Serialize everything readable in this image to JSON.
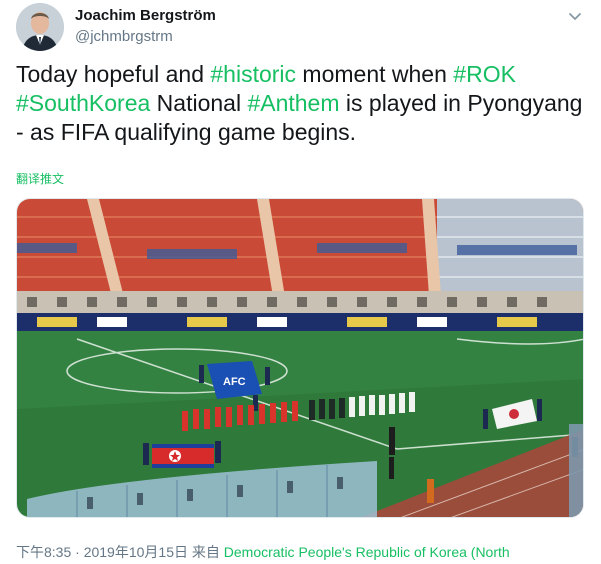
{
  "author": {
    "display_name": "Joachim Bergström",
    "handle": "@jchmbrgstrm"
  },
  "tweet": {
    "segments": [
      {
        "text": "Today hopeful and ",
        "type": "text"
      },
      {
        "text": "#historic",
        "type": "hashtag"
      },
      {
        "text": " moment when ",
        "type": "text"
      },
      {
        "text": "#ROK",
        "type": "hashtag"
      },
      {
        "text": " ",
        "type": "text"
      },
      {
        "text": "#SouthKorea",
        "type": "hashtag"
      },
      {
        "text": " National ",
        "type": "text"
      },
      {
        "text": "#Anthem",
        "type": "hashtag"
      },
      {
        "text": " is played in Pyongyang - as FIFA qualifying game begins.",
        "type": "text"
      }
    ],
    "translate_label": "翻译推文"
  },
  "media": {
    "board_texts": [
      "AFC",
      "AFC"
    ]
  },
  "meta": {
    "timestamp": "下午8:35 · 2019年10月15日",
    "from_label": " 来自 ",
    "source": "Democratic People's Republic of Korea (North"
  },
  "colors": {
    "hashtag": "#17bf63",
    "handle": "#657786",
    "pitch": "#2f7a3a",
    "seats_red": "#d0452d"
  },
  "icons": {
    "chevron": "chevron-down-icon",
    "avatar": "avatar"
  }
}
